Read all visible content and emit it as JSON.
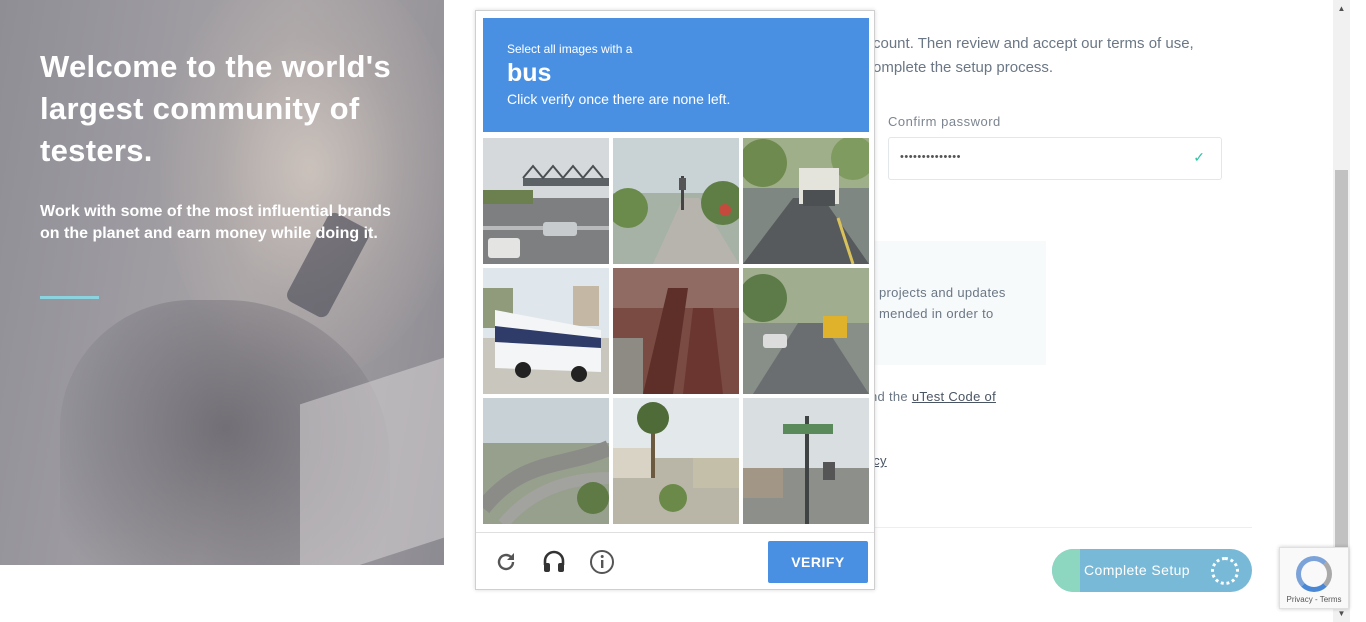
{
  "hero": {
    "headline": "Welcome to the world's largest community of testers.",
    "subtext": "Work with some of the most influential brands on the planet and earn money while doing it."
  },
  "form": {
    "intro_line1": "count. Then review and accept our terms of use,",
    "intro_line2": "omplete the setup process.",
    "confirm_password_label": "Confirm password",
    "confirm_password_value": "••••••••••••••",
    "notice_line1": "projects and updates",
    "notice_line2": "mended in order to",
    "terms_prefix": "nd the ",
    "terms_link": "uTest Code of",
    "policy_link": "icy",
    "complete_button": "Complete Setup",
    "complete_progress": 0.14
  },
  "captcha": {
    "instruction_line1": "Select all images with a",
    "target_object": "bus",
    "instruction_line3": "Click verify once there are none left.",
    "verify_label": "VERIFY",
    "tiles": [
      "highway-bridge",
      "street-with-traffic-light",
      "street-with-truck",
      "white-tour-bus",
      "red-sculpture",
      "street-with-school-bus",
      "freeway-interchange",
      "palm-tree-courtyard",
      "street-sign-pole"
    ],
    "icons": [
      "reload-icon",
      "audio-icon",
      "info-icon"
    ]
  },
  "badge": {
    "text": "Privacy - Terms"
  },
  "colors": {
    "captcha_blue": "#4a90e2",
    "accent_teal": "#8ad3df",
    "button_blue": "#78b9d7",
    "button_progress": "#8dd7c1"
  }
}
